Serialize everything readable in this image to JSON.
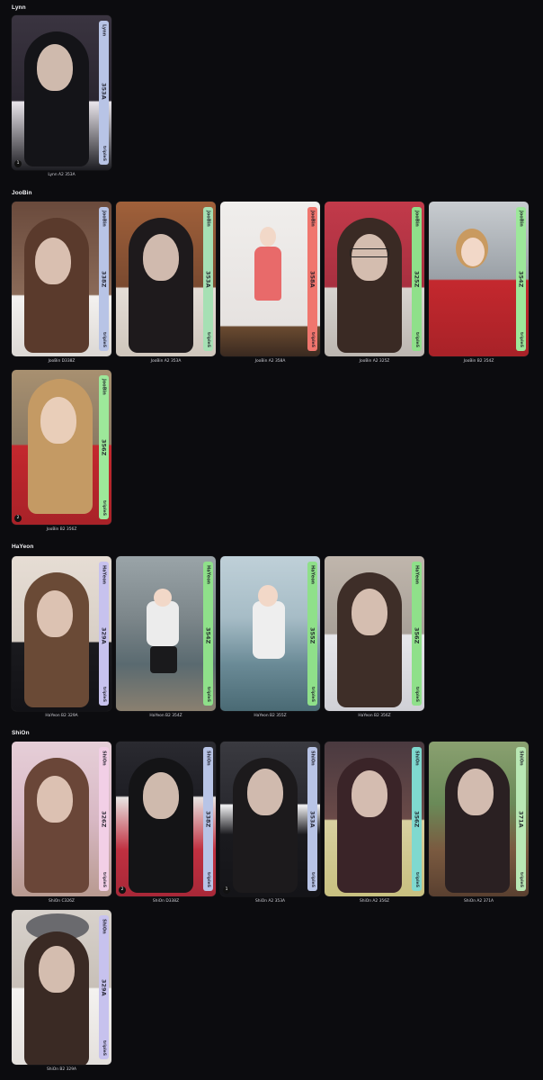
{
  "colors": {
    "background": "#0c0c0f",
    "strip_blue": "#b8c4e6",
    "strip_green": "#8fe08a",
    "strip_mint": "#a6e0b4",
    "strip_red": "#f0766e",
    "strip_lightgreen": "#9de89a",
    "strip_pink": "#f2cfe6",
    "strip_teal": "#7fd9cf",
    "strip_violet": "#c7c2ee"
  },
  "groups": [
    {
      "title": "Lynn",
      "cards": [
        {
          "name": "Lynn",
          "code": "353A",
          "brand": "tripleS",
          "caption": "Lynn A2 353A",
          "badge": "1"
        }
      ]
    },
    {
      "title": "JooBin",
      "cards": [
        {
          "name": "JooBin",
          "code": "338Z",
          "brand": "tripleS",
          "caption": "JooBin D338Z",
          "badge": ""
        },
        {
          "name": "JooBin",
          "code": "353A",
          "brand": "tripleS",
          "caption": "JooBin A2 353A",
          "badge": ""
        },
        {
          "name": "JooBin",
          "code": "358A",
          "brand": "tripleS",
          "caption": "JooBin A2 358A",
          "badge": ""
        },
        {
          "name": "JooBin",
          "code": "325Z",
          "brand": "tripleS",
          "caption": "JooBin A2 325Z",
          "badge": ""
        },
        {
          "name": "JooBin",
          "code": "354Z",
          "brand": "tripleS",
          "caption": "JooBin B2 354Z",
          "badge": ""
        },
        {
          "name": "JooBin",
          "code": "356Z",
          "brand": "tripleS",
          "caption": "JooBin B2 356Z",
          "badge": "2"
        }
      ]
    },
    {
      "title": "HaYeon",
      "cards": [
        {
          "name": "HaYeon",
          "code": "329A",
          "brand": "tripleS",
          "caption": "HaYeon B2 329A",
          "badge": ""
        },
        {
          "name": "HaYeon",
          "code": "354Z",
          "brand": "tripleS",
          "caption": "HaYeon B2 354Z",
          "badge": ""
        },
        {
          "name": "HaYeon",
          "code": "355Z",
          "brand": "tripleS",
          "caption": "HaYeon B2 355Z",
          "badge": ""
        },
        {
          "name": "HaYeon",
          "code": "356Z",
          "brand": "tripleS",
          "caption": "HaYeon B2 356Z",
          "badge": ""
        }
      ]
    },
    {
      "title": "ShiOn",
      "cards": [
        {
          "name": "ShiOn",
          "code": "326Z",
          "brand": "tripleS",
          "caption": "ShiOn C326Z",
          "badge": ""
        },
        {
          "name": "ShiOn",
          "code": "338Z",
          "brand": "tripleS",
          "caption": "ShiOn D338Z",
          "badge": "2"
        },
        {
          "name": "ShiOn",
          "code": "353A",
          "brand": "tripleS",
          "caption": "ShiOn A2 353A",
          "badge": "1"
        },
        {
          "name": "ShiOn",
          "code": "356Z",
          "brand": "tripleS",
          "caption": "ShiOn A2 356Z",
          "badge": ""
        },
        {
          "name": "ShiOn",
          "code": "371A",
          "brand": "tripleS",
          "caption": "ShiOn A2 371A",
          "badge": ""
        },
        {
          "name": "ShiOn",
          "code": "329A",
          "brand": "tripleS",
          "caption": "ShiOn B2 329A",
          "badge": ""
        }
      ]
    }
  ]
}
